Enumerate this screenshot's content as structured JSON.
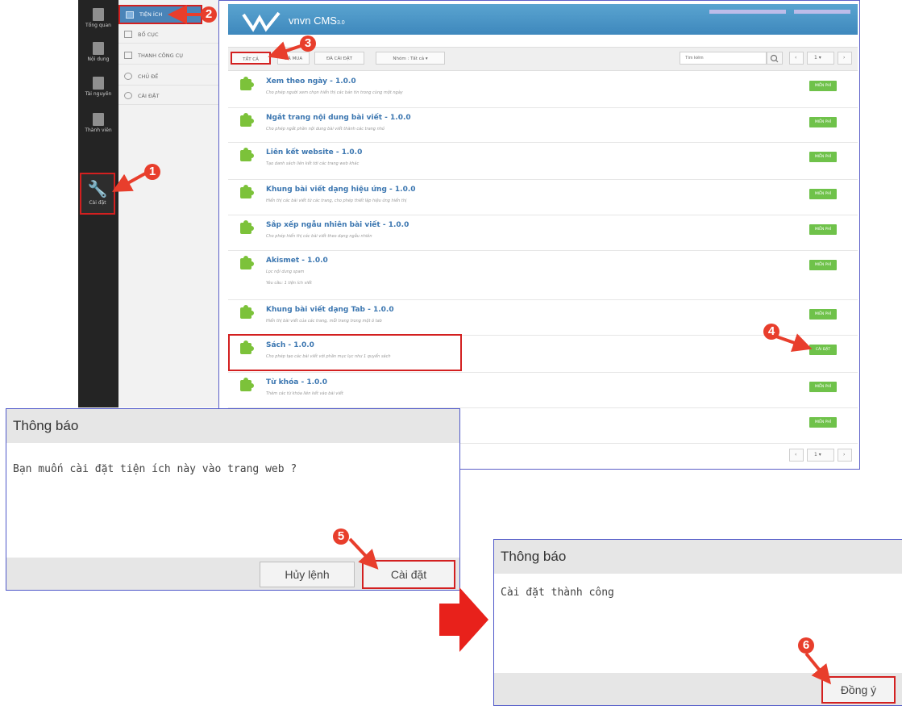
{
  "rail": {
    "items": [
      {
        "label": "Tổng quan",
        "icon": "home-icon"
      },
      {
        "label": "Nội dung",
        "icon": "document-icon"
      },
      {
        "label": "Tài nguyên",
        "icon": "folder-icon"
      },
      {
        "label": "Thành viên",
        "icon": "members-icon"
      },
      {
        "label": "Cài đặt",
        "icon": "wrench-icon"
      }
    ]
  },
  "submenu": {
    "items": [
      {
        "label": "TIỆN ÍCH"
      },
      {
        "label": "BỐ CỤC"
      },
      {
        "label": "THANH CÔNG CỤ"
      },
      {
        "label": "CHỦ ĐỀ"
      },
      {
        "label": "CÀI ĐẶT"
      }
    ]
  },
  "header": {
    "logo_main": "vnvn CMS",
    "logo_version": "3.0"
  },
  "filters": {
    "all": "TẤT CẢ",
    "paid": "ĐÃ MUA",
    "installed": "ĐÃ CÀI ĐẶT",
    "type": "Nhóm : Tất cả ▾",
    "search_placeholder": "Tìm kiếm",
    "page": "1 ▾"
  },
  "plugins": [
    {
      "title": "Xem theo ngày - 1.0.0",
      "desc": "Cho phép người xem chọn hiển thị các bản tin trong cùng một ngày",
      "req": "",
      "action": "MIỄN PHÍ"
    },
    {
      "title": "Ngắt trang nội dung bài viết - 1.0.0",
      "desc": "Cho phép ngắt phần nội dung bài viết thành các trang nhỏ",
      "req": "",
      "action": "MIỄN PHÍ"
    },
    {
      "title": "Liên kết website - 1.0.0",
      "desc": "Tạo danh sách liên kết tới các trang web khác",
      "req": "",
      "action": "MIỄN PHÍ"
    },
    {
      "title": "Khung bài viết dạng hiệu ứng - 1.0.0",
      "desc": "Hiển thị các bài viết từ các trang, cho phép thiết lập hiệu ứng hiển thị",
      "req": "",
      "action": "MIỄN PHÍ"
    },
    {
      "title": "Sắp xếp ngẫu nhiên bài viết - 1.0.0",
      "desc": "Cho phép hiển thị các bài viết theo dạng ngẫu nhiên",
      "req": "",
      "action": "MIỄN PHÍ"
    },
    {
      "title": "Akismet - 1.0.0",
      "desc": "Lọc nội dung spam",
      "req": "Yêu cầu: 1 tiện ích viết",
      "action": "MIỄN PHÍ"
    },
    {
      "title": "Khung bài viết dạng Tab - 1.0.0",
      "desc": "Hiển thị bài viết của các trang, mỗi trang trong một ô tab",
      "req": "",
      "action": "MIỄN PHÍ"
    },
    {
      "title": "Sách - 1.0.0",
      "desc": "Cho phép tạo các bài viết với phần mục lục như 1 quyển sách",
      "req": "",
      "action": "CÀI ĐẶT"
    },
    {
      "title": "Từ khóa - 1.0.0",
      "desc": "Thêm các từ khóa liên kết vào bài viết",
      "req": "",
      "action": "MIỄN PHÍ"
    },
    {
      "title": "",
      "desc": "",
      "req": "",
      "action": "MIỄN PHÍ"
    }
  ],
  "dialog_confirm": {
    "title": "Thông báo",
    "message": "Bạn muốn cài đặt tiện ích này vào trang web ?",
    "cancel": "Hủy lệnh",
    "ok": "Cài đặt"
  },
  "dialog_success": {
    "title": "Thông báo",
    "message": "Cài đặt thành công",
    "ok": "Đồng ý"
  },
  "steps": [
    "1",
    "2",
    "3",
    "4",
    "5",
    "6"
  ],
  "colors": {
    "accent_blue": "#4a8fc4",
    "annotation_red": "#e83e2c",
    "green_button": "#6fc24a",
    "dialog_border": "#4f58c9"
  }
}
